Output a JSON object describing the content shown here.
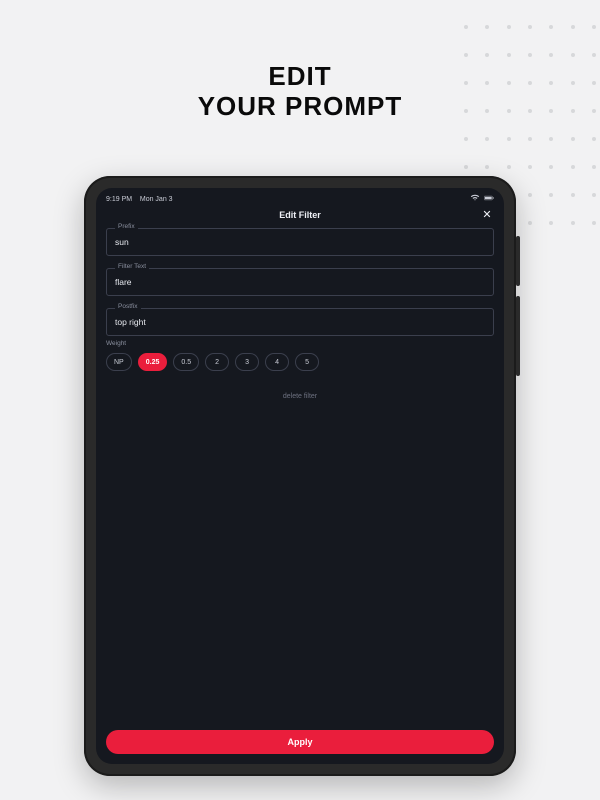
{
  "headline": {
    "line1": "EDIT",
    "line2": "YOUR PROMPT"
  },
  "statusbar": {
    "time": "9:19 PM",
    "date": "Mon Jan 3"
  },
  "titlebar": {
    "title": "Edit Filter",
    "close_label": "✕"
  },
  "fields": {
    "prefix": {
      "label": "Prefix",
      "value": "sun"
    },
    "filterText": {
      "label": "Filter Text",
      "value": "flare"
    },
    "postfix": {
      "label": "Postfix",
      "value": "top right"
    }
  },
  "weight": {
    "label": "Weight",
    "options": [
      "NP",
      "0.25",
      "0.5",
      "2",
      "3",
      "4",
      "5"
    ],
    "selected": "0.25"
  },
  "actions": {
    "delete": "delete filter",
    "apply": "Apply"
  },
  "colors": {
    "accent": "#ea1e3c",
    "screen_bg": "#15181f"
  }
}
